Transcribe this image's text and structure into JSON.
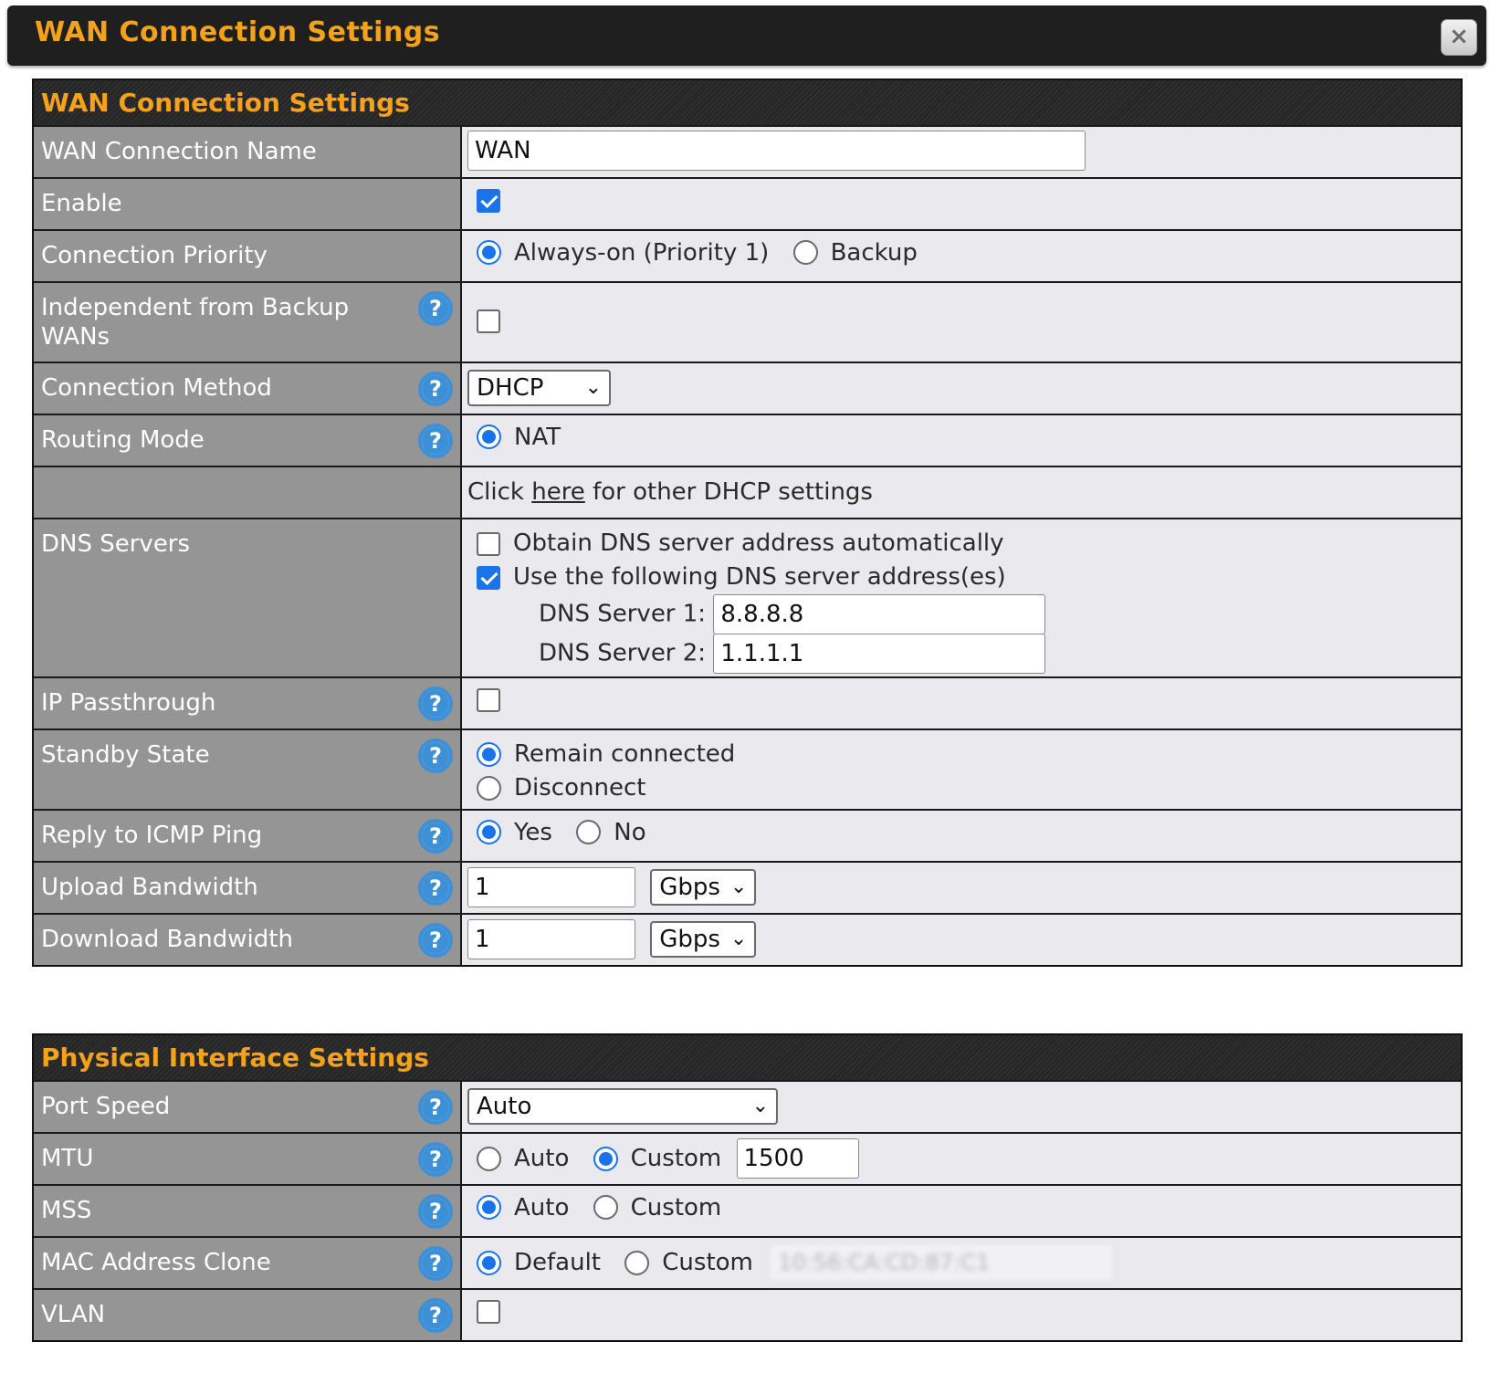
{
  "dialog": {
    "title": "WAN Connection Settings",
    "close_glyph": "×"
  },
  "wan": {
    "header": "WAN Connection Settings",
    "name": {
      "label": "WAN Connection Name",
      "value": "WAN"
    },
    "enable": {
      "label": "Enable",
      "checked": true
    },
    "priority": {
      "label": "Connection Priority",
      "option1": "Always-on (Priority 1)",
      "option2": "Backup",
      "selected": "Always-on (Priority 1)"
    },
    "independent": {
      "label": "Independent from Backup WANs",
      "checked": false
    },
    "method": {
      "label": "Connection Method",
      "value": "DHCP"
    },
    "routing": {
      "label": "Routing Mode",
      "option": "NAT"
    },
    "dhcp_note": {
      "prefix": "Click ",
      "link": "here",
      "suffix": " for other DHCP settings"
    },
    "dns": {
      "label": "DNS Servers",
      "auto": "Obtain DNS server address automatically",
      "manual": "Use the following DNS server address(es)",
      "server1_label": "DNS Server 1:",
      "server1": "8.8.8.8",
      "server2_label": "DNS Server 2:",
      "server2": "1.1.1.1"
    },
    "passthrough": {
      "label": "IP Passthrough",
      "checked": false
    },
    "standby": {
      "label": "Standby State",
      "option1": "Remain connected",
      "option2": "Disconnect",
      "selected": "Remain connected"
    },
    "icmp": {
      "label": "Reply to ICMP Ping",
      "yes": "Yes",
      "no": "No",
      "selected": "Yes"
    },
    "upload": {
      "label": "Upload Bandwidth",
      "value": "1",
      "unit": "Gbps"
    },
    "download": {
      "label": "Download Bandwidth",
      "value": "1",
      "unit": "Gbps"
    }
  },
  "physical": {
    "header": "Physical Interface Settings",
    "port_speed": {
      "label": "Port Speed",
      "value": "Auto"
    },
    "mtu": {
      "label": "MTU",
      "auto": "Auto",
      "custom": "Custom",
      "value": "1500",
      "selected": "Custom"
    },
    "mss": {
      "label": "MSS",
      "auto": "Auto",
      "custom": "Custom",
      "selected": "Auto"
    },
    "mac": {
      "label": "MAC Address Clone",
      "default": "Default",
      "custom": "Custom",
      "value": "10:56:CA:CD:87:C1",
      "selected": "Default"
    },
    "vlan": {
      "label": "VLAN",
      "checked": false
    }
  },
  "icons": {
    "help": "help-icon",
    "close": "close-icon",
    "dropdown": "chevron-down-icon"
  },
  "colors": {
    "accent": "#f4a21b",
    "label_bg": "#959595",
    "value_bg": "#e9e9ee",
    "selected": "#1a73e8",
    "help": "#3d8fd6"
  }
}
